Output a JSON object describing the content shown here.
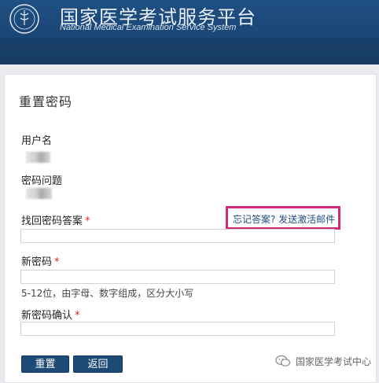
{
  "header": {
    "title": "国家医学考试服务平台",
    "subtitle": "National Medical Examination Service System"
  },
  "form": {
    "page_title": "重置密码",
    "username_label": "用户名",
    "security_question_label": "密码问题",
    "answer_label": "找回密码答案",
    "forgot_answer_link": "忘记答案? 发送激活邮件",
    "new_password_label": "新密码",
    "password_hint": "5-12位，由字母、数字组成，区分大小写",
    "confirm_password_label": "新密码确认",
    "required_mark": "*",
    "answer_value": "",
    "new_password_value": "",
    "confirm_password_value": ""
  },
  "buttons": {
    "reset": "重置",
    "back": "返回"
  },
  "watermark": {
    "text": "国家医学考试中心"
  },
  "colors": {
    "header_bg": "#1b4675",
    "button_bg": "#1d4a76",
    "highlight_border": "#d2287a",
    "link": "#1f4f82",
    "required": "#d22222"
  }
}
